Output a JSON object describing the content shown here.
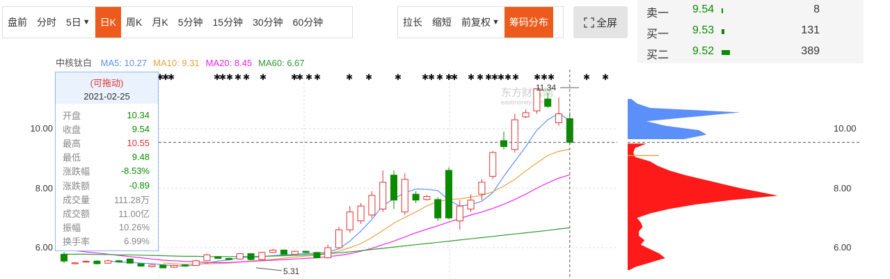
{
  "toolbar": {
    "periods": [
      {
        "label": "盘前",
        "name": "period-premarket"
      },
      {
        "label": "分时",
        "name": "period-intraday"
      },
      {
        "label": "5日",
        "name": "period-5day",
        "caret": true
      },
      {
        "label": "日K",
        "name": "period-daily-k",
        "active": true
      },
      {
        "label": "周K",
        "name": "period-weekly-k"
      },
      {
        "label": "月K",
        "name": "period-monthly-k"
      },
      {
        "label": "5分钟",
        "name": "period-5min"
      },
      {
        "label": "15分钟",
        "name": "period-15min"
      },
      {
        "label": "30分钟",
        "name": "period-30min"
      },
      {
        "label": "60分钟",
        "name": "period-60min"
      }
    ],
    "tools": [
      {
        "label": "拉长",
        "name": "stretch-button"
      },
      {
        "label": "缩短",
        "name": "shrink-button"
      },
      {
        "label": "前复权",
        "name": "adjust-dropdown",
        "caret": true
      },
      {
        "label": "筹码分布",
        "name": "chip-distribution-button",
        "active": true
      }
    ],
    "fullscreen": "全屏",
    "accent": "#ec5b1c"
  },
  "orderbook": [
    {
      "label": "卖一",
      "price": "9.54",
      "volume": "8",
      "bar": 0.01
    },
    {
      "label": "买一",
      "price": "9.53",
      "volume": "131",
      "bar": 0.17
    },
    {
      "label": "买二",
      "price": "9.52",
      "volume": "389",
      "bar": 0.5
    }
  ],
  "legend": {
    "stock": "中核钛白",
    "items": [
      {
        "text": "MA5: 10.27",
        "color": "#5b8ff9"
      },
      {
        "text": "MA10: 9.31",
        "color": "#e8a23b"
      },
      {
        "text": "MA20: 8.45",
        "color": "#ee22ee"
      },
      {
        "text": "MA60: 6.67",
        "color": "#2f9a2f"
      }
    ]
  },
  "tooltip": {
    "drag_hint": "(可拖动)",
    "date": "2021-02-25",
    "rows": [
      {
        "k": "开盘",
        "v": "10.34",
        "color": "#0b8a00"
      },
      {
        "k": "收盘",
        "v": "9.54",
        "color": "#0b8a00"
      },
      {
        "k": "最高",
        "v": "10.55",
        "color": "#e03030"
      },
      {
        "k": "最低",
        "v": "9.48",
        "color": "#0b8a00"
      },
      {
        "k": "涨跌幅",
        "v": "-8.53%",
        "color": "#0b8a00"
      },
      {
        "k": "涨跌额",
        "v": "-0.89",
        "color": "#0b8a00"
      },
      {
        "k": "成交量",
        "v": "111.28万",
        "color": "#888"
      },
      {
        "k": "成交额",
        "v": "11.00亿",
        "color": "#888"
      },
      {
        "k": "振幅",
        "v": "10.26%",
        "color": "#888"
      },
      {
        "k": "换手率",
        "v": "6.99%",
        "color": "#888"
      }
    ]
  },
  "watermark": {
    "brand": "东方财富网",
    "site": "eastmoney.com"
  },
  "chart_data": {
    "type": "candlestick",
    "y_ticks": [
      "10.00",
      "8.00",
      "6.00"
    ],
    "ylim": [
      5.1,
      11.6
    ],
    "max_label": "11.34",
    "min_label": "5.31",
    "current_price": 9.54,
    "candles": [
      {
        "o": 5.78,
        "c": 5.55,
        "h": 5.86,
        "l": 5.48
      },
      {
        "o": 5.46,
        "c": 5.49,
        "h": 5.52,
        "l": 5.44
      },
      {
        "o": 5.52,
        "c": 5.54,
        "h": 5.58,
        "l": 5.5
      },
      {
        "o": 5.55,
        "c": 5.46,
        "h": 5.58,
        "l": 5.44
      },
      {
        "o": 5.48,
        "c": 5.56,
        "h": 5.6,
        "l": 5.46
      },
      {
        "o": 5.56,
        "c": 5.52,
        "h": 5.6,
        "l": 5.5
      },
      {
        "o": 5.62,
        "c": 5.48,
        "h": 5.64,
        "l": 5.46
      },
      {
        "o": 5.46,
        "c": 5.38,
        "h": 5.48,
        "l": 5.36
      },
      {
        "o": 5.36,
        "c": 5.42,
        "h": 5.44,
        "l": 5.34
      },
      {
        "o": 5.42,
        "c": 5.32,
        "h": 5.44,
        "l": 5.31
      },
      {
        "o": 5.34,
        "c": 5.4,
        "h": 5.42,
        "l": 5.32
      },
      {
        "o": 5.42,
        "c": 5.38,
        "h": 5.44,
        "l": 5.36
      },
      {
        "o": 5.4,
        "c": 5.56,
        "h": 5.6,
        "l": 5.38
      },
      {
        "o": 5.56,
        "c": 5.76,
        "h": 5.8,
        "l": 5.54
      },
      {
        "o": 5.7,
        "c": 5.64,
        "h": 5.72,
        "l": 5.62
      },
      {
        "o": 5.64,
        "c": 5.6,
        "h": 5.66,
        "l": 5.58
      },
      {
        "o": 5.62,
        "c": 5.8,
        "h": 5.82,
        "l": 5.6
      },
      {
        "o": 5.8,
        "c": 5.6,
        "h": 5.82,
        "l": 5.58
      },
      {
        "o": 5.6,
        "c": 5.84,
        "h": 5.86,
        "l": 5.58
      },
      {
        "o": 5.84,
        "c": 5.92,
        "h": 5.96,
        "l": 5.82
      },
      {
        "o": 5.92,
        "c": 5.78,
        "h": 5.94,
        "l": 5.76
      },
      {
        "o": 5.78,
        "c": 5.88,
        "h": 5.9,
        "l": 5.76
      },
      {
        "o": 5.88,
        "c": 5.84,
        "h": 5.9,
        "l": 5.82
      },
      {
        "o": 5.84,
        "c": 5.66,
        "h": 5.86,
        "l": 5.64
      },
      {
        "o": 5.66,
        "c": 6.0,
        "h": 6.1,
        "l": 5.64
      },
      {
        "o": 6.0,
        "c": 6.6,
        "h": 6.7,
        "l": 5.98
      },
      {
        "o": 6.6,
        "c": 7.2,
        "h": 7.4,
        "l": 6.5
      },
      {
        "o": 6.9,
        "c": 7.4,
        "h": 7.5,
        "l": 6.8
      },
      {
        "o": 7.1,
        "c": 7.76,
        "h": 7.9,
        "l": 7.0
      },
      {
        "o": 7.3,
        "c": 8.2,
        "h": 8.6,
        "l": 7.2
      },
      {
        "o": 8.44,
        "c": 7.6,
        "h": 8.6,
        "l": 7.3
      },
      {
        "o": 7.2,
        "c": 8.3,
        "h": 8.5,
        "l": 7.1
      },
      {
        "o": 7.8,
        "c": 7.6,
        "h": 7.9,
        "l": 7.5
      },
      {
        "o": 7.62,
        "c": 7.72,
        "h": 7.78,
        "l": 7.58
      },
      {
        "o": 7.62,
        "c": 7.0,
        "h": 7.7,
        "l": 6.9
      },
      {
        "o": 8.6,
        "c": 7.0,
        "h": 8.7,
        "l": 6.95
      },
      {
        "o": 6.9,
        "c": 7.4,
        "h": 7.6,
        "l": 6.6
      },
      {
        "o": 7.3,
        "c": 7.6,
        "h": 7.8,
        "l": 7.2
      },
      {
        "o": 7.8,
        "c": 8.2,
        "h": 8.3,
        "l": 7.6
      },
      {
        "o": 8.4,
        "c": 9.2,
        "h": 9.25,
        "l": 8.3
      },
      {
        "o": 9.6,
        "c": 9.4,
        "h": 9.9,
        "l": 9.3
      },
      {
        "o": 9.3,
        "c": 10.3,
        "h": 10.5,
        "l": 9.2
      },
      {
        "o": 10.4,
        "c": 10.54,
        "h": 10.65,
        "l": 10.35
      },
      {
        "o": 10.6,
        "c": 11.34,
        "h": 11.34,
        "l": 10.5
      },
      {
        "o": 11.0,
        "c": 10.75,
        "h": 11.2,
        "l": 10.7
      },
      {
        "o": 10.2,
        "c": 10.5,
        "h": 11.05,
        "l": 10.1
      },
      {
        "o": 10.34,
        "c": 9.54,
        "h": 10.55,
        "l": 9.48
      }
    ],
    "ma_lines": [
      {
        "name": "MA5",
        "color": "#5b8ff9",
        "values": [
          null,
          null,
          null,
          null,
          5.56,
          5.51,
          5.51,
          5.48,
          5.47,
          5.42,
          5.4,
          5.38,
          5.42,
          5.48,
          5.55,
          5.59,
          5.67,
          5.68,
          5.7,
          5.73,
          5.76,
          5.78,
          5.8,
          5.82,
          5.86,
          5.96,
          6.22,
          6.56,
          6.95,
          7.42,
          7.64,
          7.85,
          7.97,
          7.96,
          7.92,
          7.6,
          7.4,
          7.45,
          7.56,
          7.85,
          8.4,
          8.9,
          9.4,
          9.95,
          10.3,
          10.52,
          10.27
        ]
      },
      {
        "name": "MA10",
        "color": "#e8a23b",
        "values": [
          null,
          null,
          null,
          null,
          null,
          null,
          null,
          null,
          null,
          5.49,
          5.46,
          5.44,
          5.45,
          5.46,
          5.47,
          5.48,
          5.52,
          5.55,
          5.58,
          5.61,
          5.65,
          5.68,
          5.72,
          5.74,
          5.8,
          5.88,
          6.0,
          6.14,
          6.34,
          6.58,
          6.82,
          7.02,
          7.2,
          7.4,
          7.55,
          7.62,
          7.64,
          7.7,
          7.76,
          7.88,
          8.07,
          8.3,
          8.58,
          8.85,
          9.1,
          9.24,
          9.31
        ]
      },
      {
        "name": "MA20",
        "color": "#ee22ee",
        "values": [
          5.95,
          5.9,
          5.86,
          5.82,
          5.78,
          5.74,
          5.7,
          5.66,
          5.62,
          5.58,
          5.56,
          5.54,
          5.52,
          5.5,
          5.5,
          5.5,
          5.52,
          5.54,
          5.56,
          5.58,
          5.6,
          5.62,
          5.64,
          5.66,
          5.7,
          5.74,
          5.8,
          5.88,
          5.98,
          6.1,
          6.22,
          6.36,
          6.5,
          6.62,
          6.74,
          6.86,
          6.98,
          7.1,
          7.2,
          7.32,
          7.46,
          7.62,
          7.8,
          8.0,
          8.18,
          8.34,
          8.45
        ]
      },
      {
        "name": "MA60",
        "color": "#2f9a2f",
        "values": [
          5.78,
          5.78,
          5.78,
          5.77,
          5.77,
          5.76,
          5.76,
          5.75,
          5.74,
          5.73,
          5.72,
          5.71,
          5.71,
          5.7,
          5.7,
          5.7,
          5.7,
          5.7,
          5.71,
          5.72,
          5.73,
          5.74,
          5.76,
          5.78,
          5.8,
          5.83,
          5.86,
          5.9,
          5.94,
          5.98,
          6.02,
          6.06,
          6.1,
          6.14,
          6.18,
          6.22,
          6.26,
          6.3,
          6.34,
          6.38,
          6.42,
          6.46,
          6.5,
          6.54,
          6.58,
          6.63,
          6.67
        ]
      }
    ]
  },
  "chip_distribution": {
    "profit_color": "#5b8ff9",
    "loss_color": "#ff1a1a",
    "cost_line_price": 9.1,
    "cost_line_color": "#e8a23b",
    "profile": [
      {
        "price": 11.0,
        "w": 0.02
      },
      {
        "price": 10.85,
        "w": 0.05
      },
      {
        "price": 10.7,
        "w": 0.12
      },
      {
        "price": 10.55,
        "w": 0.6
      },
      {
        "price": 10.4,
        "w": 0.35
      },
      {
        "price": 10.25,
        "w": 0.1
      },
      {
        "price": 10.1,
        "w": 0.2
      },
      {
        "price": 9.95,
        "w": 0.38
      },
      {
        "price": 9.8,
        "w": 0.42
      },
      {
        "price": 9.65,
        "w": 0.3
      },
      {
        "price": 9.5,
        "w": 0.1
      },
      {
        "price": 9.35,
        "w": 0.04
      },
      {
        "price": 9.2,
        "w": 0.03
      },
      {
        "price": 9.05,
        "w": 0.04
      },
      {
        "price": 8.9,
        "w": 0.12
      },
      {
        "price": 8.75,
        "w": 0.16
      },
      {
        "price": 8.6,
        "w": 0.22
      },
      {
        "price": 8.45,
        "w": 0.3
      },
      {
        "price": 8.3,
        "w": 0.4
      },
      {
        "price": 8.15,
        "w": 0.5
      },
      {
        "price": 8.0,
        "w": 0.6
      },
      {
        "price": 7.85,
        "w": 0.72
      },
      {
        "price": 7.75,
        "w": 0.8
      },
      {
        "price": 7.6,
        "w": 0.55
      },
      {
        "price": 7.45,
        "w": 0.36
      },
      {
        "price": 7.3,
        "w": 0.22
      },
      {
        "price": 7.15,
        "w": 0.12
      },
      {
        "price": 7.0,
        "w": 0.05
      },
      {
        "price": 6.85,
        "w": 0.07
      },
      {
        "price": 6.7,
        "w": 0.08
      },
      {
        "price": 6.55,
        "w": 0.06
      },
      {
        "price": 6.4,
        "w": 0.06
      },
      {
        "price": 6.25,
        "w": 0.09
      },
      {
        "price": 6.1,
        "w": 0.07
      },
      {
        "price": 5.95,
        "w": 0.12
      },
      {
        "price": 5.8,
        "w": 0.17
      },
      {
        "price": 5.65,
        "w": 0.2
      },
      {
        "price": 5.5,
        "w": 0.12
      },
      {
        "price": 5.35,
        "w": 0.04
      },
      {
        "price": 5.25,
        "w": 0.01
      }
    ]
  }
}
